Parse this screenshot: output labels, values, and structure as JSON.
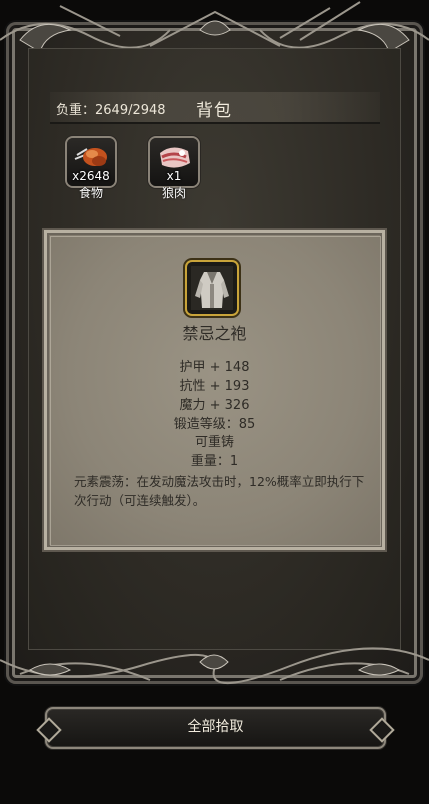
{
  "inventory": {
    "weight_label": "负重：2649/2948",
    "title": "背包",
    "items": [
      {
        "icon": "meat-drumstick-icon",
        "quantity": "x2648",
        "label": "食物"
      },
      {
        "icon": "raw-wolf-meat-icon",
        "quantity": "x1",
        "label": "狼肉"
      }
    ]
  },
  "item_detail": {
    "icon": "robe-armor-icon",
    "name": "禁忌之袍",
    "stats": [
      "护甲 + 148",
      "抗性 + 193",
      "魔力 + 326",
      "锻造等级：85",
      "可重铸",
      "重量：1"
    ],
    "effect": "元素震荡：在发动魔法攻击时，12%概率立即执行下次行动（可连续触发）。"
  },
  "actions": {
    "pickup_all_label": "全部拾取"
  },
  "colors": {
    "frame": "#2b2823",
    "detail_panel": "#8f887a",
    "item_border_gold": "#c9a43a"
  }
}
